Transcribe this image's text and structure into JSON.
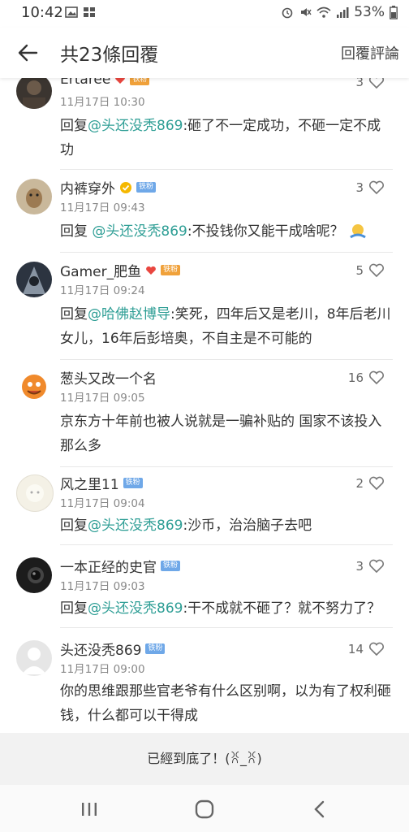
{
  "status_bar": {
    "time": "10:42",
    "battery": "53%"
  },
  "header": {
    "title": "共23條回覆",
    "action": "回覆評論"
  },
  "comments": [
    {
      "name": "Ertaree",
      "badge": "铁粉",
      "time": "11月17日 10:30",
      "likes": "3",
      "prefix": "回复",
      "mention": "@头还没秃869",
      "text": ":砸了不一定成功，不砸一定不成功"
    },
    {
      "name": "内裤穿外",
      "badge": "铁粉",
      "time": "11月17日 09:43",
      "likes": "3",
      "prefix": "回复 ",
      "mention": "@头还没秃869",
      "text": ":不投钱你又能干成啥呢？"
    },
    {
      "name": "Gamer_肥鱼",
      "badge": "铁粉",
      "time": "11月17日 09:24",
      "likes": "5",
      "prefix": "回复",
      "mention": "@哈佛赵博导",
      "text": ":笑死，四年后又是老川，8年后老川女儿，16年后彭培奥，不自主是不可能的"
    },
    {
      "name": "葱头又改一个名",
      "badge": "",
      "time": "11月17日 09:05",
      "likes": "16",
      "prefix": "",
      "mention": "",
      "text": "京东方十年前也被人说就是一骗补贴的 国家不该投入那么多"
    },
    {
      "name": "风之里11",
      "badge": "铁粉",
      "time": "11月17日 09:04",
      "likes": "2",
      "prefix": "回复",
      "mention": "@头还没秃869",
      "text": ":沙币，治治脑子去吧"
    },
    {
      "name": "一本正经的史官",
      "badge": "铁粉",
      "time": "11月17日 09:03",
      "likes": "3",
      "prefix": "回复",
      "mention": "@头还没秃869",
      "text": ":干不成就不砸了？就不努力了？"
    },
    {
      "name": "头还没秃869",
      "badge": "铁粉",
      "time": "11月17日 09:00",
      "likes": "14",
      "prefix": "",
      "mention": "",
      "text": "你的思维跟那些官老爷有什么区别啊，以为有了权利砸钱，什么都可以干得成"
    }
  ],
  "footer": {
    "end_text": "已經到底了！(ꐦ_ꐦ)"
  },
  "icons": {
    "back": "arrow-left-icon",
    "like": "heart-outline-icon",
    "nav": [
      "recent-apps-icon",
      "home-icon",
      "back-nav-icon"
    ]
  }
}
